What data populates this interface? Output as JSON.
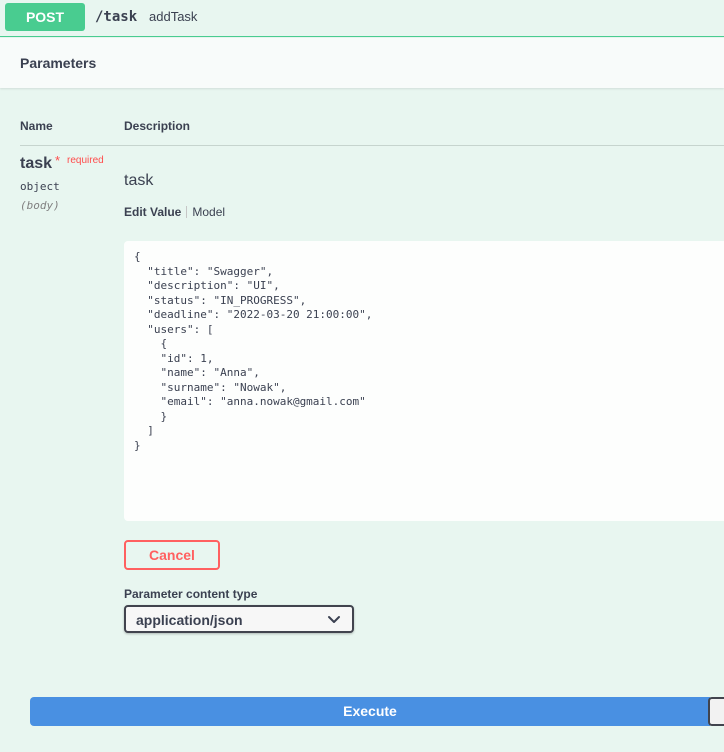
{
  "operation": {
    "method": "POST",
    "path": "/task",
    "summary": "addTask"
  },
  "parameters": {
    "section_title": "Parameters",
    "columns": {
      "name": "Name",
      "description": "Description"
    },
    "param": {
      "name": "task",
      "required_star": "*",
      "required_label": "required",
      "type": "object",
      "in": "(body)",
      "description": "task"
    },
    "tabs": {
      "edit_value": "Edit Value",
      "model": "Model"
    },
    "body_value": "{\n  \"title\": \"Swagger\",\n  \"description\": \"UI\",\n  \"status\": \"IN_PROGRESS\",\n  \"deadline\": \"2022-03-20 21:00:00\",\n  \"users\": [\n    {\n    \"id\": 1,\n    \"name\": \"Anna\",\n    \"surname\": \"Nowak\",\n    \"email\": \"anna.nowak@gmail.com\"\n    }\n  ]\n}",
    "cancel_label": "Cancel",
    "content_type_label": "Parameter content type",
    "content_type_value": "application/json"
  },
  "execute_label": "Execute",
  "colors": {
    "post": "#49cc90",
    "background": "#e8f6f0",
    "execute": "#4990e2",
    "cancel": "#ff6060",
    "required": "#ff4c4c"
  },
  "icons": {
    "select_arrow": "chevron-down-icon"
  }
}
